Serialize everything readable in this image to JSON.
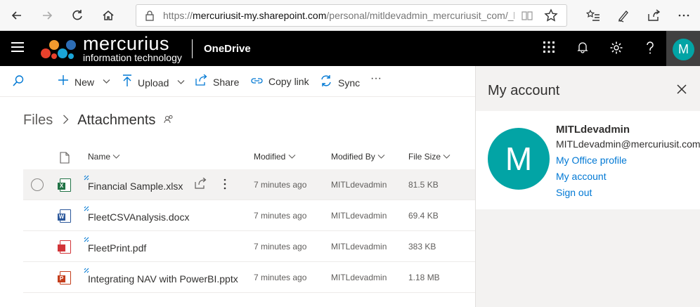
{
  "browser": {
    "url_prefix": "https://",
    "url_host": "mercuriusit-my.sharepoint.com",
    "url_path": "/personal/mitldevadmin_mercuriusit_com/_layou"
  },
  "suite": {
    "brand_main": "mercurius",
    "brand_sub": "information technology",
    "app_name": "OneDrive",
    "avatar_initial": "M"
  },
  "commands": {
    "new": "New",
    "upload": "Upload",
    "share": "Share",
    "copy_link": "Copy link",
    "sync": "Sync",
    "more": "···"
  },
  "breadcrumb": {
    "root": "Files",
    "current": "Attachments"
  },
  "columns": {
    "name": "Name",
    "modified": "Modified",
    "modified_by": "Modified By",
    "file_size": "File Size"
  },
  "files": [
    {
      "name": "Financial Sample.xlsx",
      "modified": "7 minutes ago",
      "modified_by": "MITLdevadmin",
      "size": "81.5 KB",
      "type": "excel",
      "tag": "X",
      "color": "#217346"
    },
    {
      "name": "FleetCSVAnalysis.docx",
      "modified": "7 minutes ago",
      "modified_by": "MITLdevadmin",
      "size": "69.4 KB",
      "type": "word",
      "tag": "W",
      "color": "#2b579a"
    },
    {
      "name": "FleetPrint.pdf",
      "modified": "7 minutes ago",
      "modified_by": "MITLdevadmin",
      "size": "383 KB",
      "type": "pdf",
      "tag": "",
      "color": "#d13438"
    },
    {
      "name": "Integrating NAV with PowerBI.pptx",
      "modified": "7 minutes ago",
      "modified_by": "MITLdevadmin",
      "size": "1.18 MB",
      "type": "powerpoint",
      "tag": "P",
      "color": "#c43e1c"
    }
  ],
  "account": {
    "title": "My account",
    "initial": "M",
    "name": "MITLdevadmin",
    "email": "MITLdevadmin@mercuriusit.com",
    "links": [
      "My Office profile",
      "My account",
      "Sign out"
    ]
  },
  "colors": {
    "accent": "#0078d4",
    "avatar": "#02a4a5",
    "suitebar": "#000000"
  }
}
